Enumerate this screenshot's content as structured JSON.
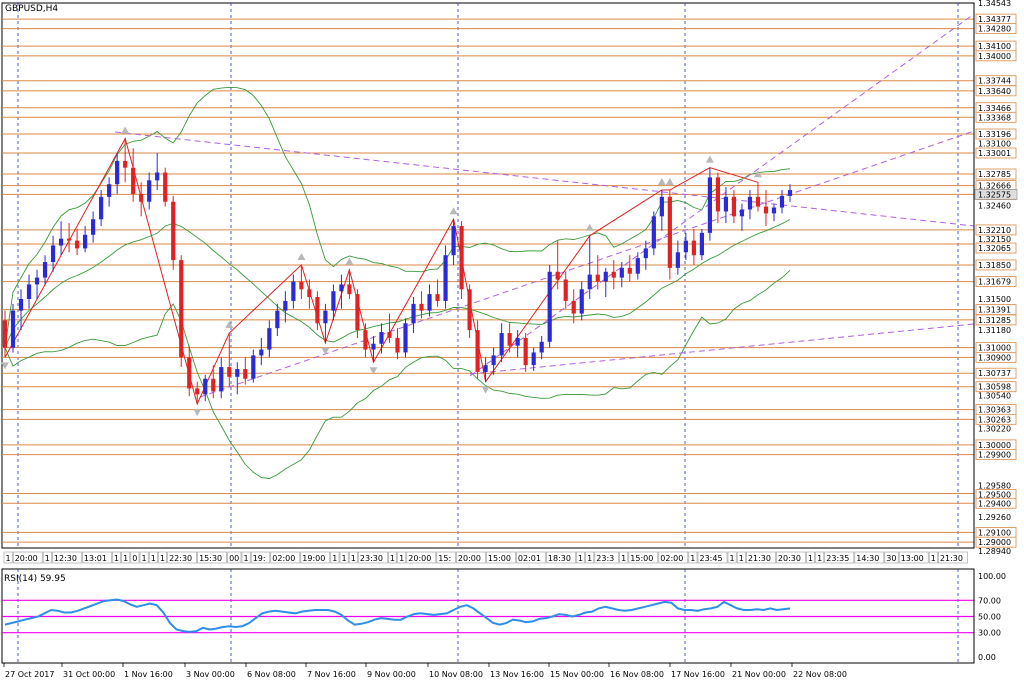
{
  "chart_data": [
    {
      "type": "candlestick",
      "title": "GBPUSD,H4",
      "ylim": [
        1.2894,
        1.34543
      ],
      "price_labels": [
        "1.34543",
        "1.34377",
        "1.34280",
        "1.34100",
        "1.34000",
        "1.33744",
        "1.33640",
        "1.33466",
        "1.33368",
        "1.33196",
        "1.33100",
        "1.33001",
        "1.32785",
        "1.32666",
        "1.32575",
        "1.32460",
        "1.32210",
        "1.32150",
        "1.32065",
        "1.31850",
        "1.31679",
        "1.31500",
        "1.31391",
        "1.31285",
        "1.31180",
        "1.31000",
        "1.30900",
        "1.30737",
        "1.30598",
        "1.30540",
        "1.30363",
        "1.30263",
        "1.30220",
        "1.30000",
        "1.29900",
        "1.29580",
        "1.29500",
        "1.29400",
        "1.29260",
        "1.29100",
        "1.29000",
        "1.28940"
      ],
      "current_price": "1.32575",
      "horizontal_levels": [
        1.34377,
        1.3428,
        1.341,
        1.34,
        1.33744,
        1.3364,
        1.33466,
        1.33368,
        1.33196,
        1.33001,
        1.32785,
        1.32666,
        1.32575,
        1.3221,
        1.32065,
        1.3185,
        1.31679,
        1.31391,
        1.31285,
        1.31,
        1.309,
        1.30737,
        1.30598,
        1.30363,
        1.30263,
        1.3,
        1.299,
        1.295,
        1.294,
        1.291,
        1.29
      ],
      "candles": [
        [
          1.3128,
          1.3138,
          1.309,
          1.31
        ],
        [
          1.31,
          1.3145,
          1.3095,
          1.3138
        ],
        [
          1.3138,
          1.316,
          1.3118,
          1.315
        ],
        [
          1.315,
          1.3175,
          1.314,
          1.3165
        ],
        [
          1.3165,
          1.318,
          1.315,
          1.3172
        ],
        [
          1.3172,
          1.3195,
          1.3165,
          1.3188
        ],
        [
          1.3188,
          1.3215,
          1.3178,
          1.3205
        ],
        [
          1.3205,
          1.323,
          1.3195,
          1.3212
        ],
        [
          1.3212,
          1.3228,
          1.3198,
          1.321
        ],
        [
          1.321,
          1.3222,
          1.3195,
          1.3202
        ],
        [
          1.3202,
          1.3225,
          1.3198,
          1.3216
        ],
        [
          1.3216,
          1.324,
          1.3208,
          1.3232
        ],
        [
          1.3232,
          1.3262,
          1.3225,
          1.3255
        ],
        [
          1.3255,
          1.3275,
          1.3245,
          1.3268
        ],
        [
          1.3268,
          1.33,
          1.3258,
          1.3292
        ],
        [
          1.3292,
          1.3315,
          1.327,
          1.3285
        ],
        [
          1.3285,
          1.3305,
          1.325,
          1.3258
        ],
        [
          1.3258,
          1.327,
          1.3235,
          1.325
        ],
        [
          1.325,
          1.328,
          1.3242,
          1.3272
        ],
        [
          1.3272,
          1.33,
          1.3262,
          1.328
        ],
        [
          1.328,
          1.3285,
          1.3245,
          1.325
        ],
        [
          1.325,
          1.3256,
          1.318,
          1.319
        ],
        [
          1.319,
          1.3195,
          1.308,
          1.309
        ],
        [
          1.309,
          1.3102,
          1.305,
          1.3058
        ],
        [
          1.3058,
          1.3065,
          1.3042,
          1.3052
        ],
        [
          1.3052,
          1.3072,
          1.3045,
          1.3068
        ],
        [
          1.3068,
          1.3082,
          1.3048,
          1.3055
        ],
        [
          1.3055,
          1.309,
          1.3048,
          1.308
        ],
        [
          1.308,
          1.3115,
          1.306,
          1.307
        ],
        [
          1.307,
          1.3085,
          1.3052,
          1.3078
        ],
        [
          1.3078,
          1.309,
          1.3062,
          1.3068
        ],
        [
          1.3068,
          1.3098,
          1.3064,
          1.3092
        ],
        [
          1.3092,
          1.311,
          1.3082,
          1.3098
        ],
        [
          1.3098,
          1.3128,
          1.309,
          1.312
        ],
        [
          1.312,
          1.3145,
          1.3112,
          1.3138
        ],
        [
          1.3138,
          1.3158,
          1.3126,
          1.3148
        ],
        [
          1.3148,
          1.3175,
          1.314,
          1.3168
        ],
        [
          1.3168,
          1.3185,
          1.315,
          1.316
        ],
        [
          1.316,
          1.317,
          1.314,
          1.3152
        ],
        [
          1.3152,
          1.3158,
          1.3118,
          1.3125
        ],
        [
          1.3125,
          1.3145,
          1.3105,
          1.3138
        ],
        [
          1.3138,
          1.3165,
          1.3128,
          1.3158
        ],
        [
          1.3158,
          1.3175,
          1.314,
          1.3165
        ],
        [
          1.3165,
          1.318,
          1.315,
          1.3155
        ],
        [
          1.3155,
          1.316,
          1.311,
          1.3118
        ],
        [
          1.3118,
          1.3125,
          1.309,
          1.3098
        ],
        [
          1.3098,
          1.3112,
          1.3085,
          1.3104
        ],
        [
          1.3104,
          1.3125,
          1.3094,
          1.3116
        ],
        [
          1.3116,
          1.3135,
          1.3105,
          1.311
        ],
        [
          1.311,
          1.312,
          1.3088,
          1.3095
        ],
        [
          1.3095,
          1.313,
          1.309,
          1.3125
        ],
        [
          1.3125,
          1.3152,
          1.3115,
          1.3145
        ],
        [
          1.3145,
          1.3158,
          1.313,
          1.3138
        ],
        [
          1.3138,
          1.3165,
          1.3132,
          1.3155
        ],
        [
          1.3155,
          1.317,
          1.3142,
          1.3148
        ],
        [
          1.3148,
          1.3205,
          1.314,
          1.3195
        ],
        [
          1.3195,
          1.3232,
          1.3185,
          1.3225
        ],
        [
          1.3225,
          1.323,
          1.315,
          1.316
        ],
        [
          1.316,
          1.3165,
          1.311,
          1.3118
        ],
        [
          1.3118,
          1.3128,
          1.3068,
          1.3075
        ],
        [
          1.3075,
          1.309,
          1.3065,
          1.3082
        ],
        [
          1.3082,
          1.31,
          1.3072,
          1.3092
        ],
        [
          1.3092,
          1.3125,
          1.3085,
          1.3115
        ],
        [
          1.3115,
          1.3125,
          1.3095,
          1.3102
        ],
        [
          1.3102,
          1.3118,
          1.309,
          1.311
        ],
        [
          1.311,
          1.3115,
          1.3075,
          1.3082
        ],
        [
          1.3082,
          1.31,
          1.3076,
          1.3095
        ],
        [
          1.3095,
          1.3112,
          1.3088,
          1.3106
        ],
        [
          1.3106,
          1.3185,
          1.31,
          1.3178
        ],
        [
          1.3178,
          1.321,
          1.316,
          1.317
        ],
        [
          1.317,
          1.3178,
          1.314,
          1.3148
        ],
        [
          1.3148,
          1.316,
          1.3125,
          1.3135
        ],
        [
          1.3135,
          1.3168,
          1.3128,
          1.316
        ],
        [
          1.316,
          1.3215,
          1.315,
          1.3175
        ],
        [
          1.3175,
          1.3195,
          1.316,
          1.3168
        ],
        [
          1.3168,
          1.3182,
          1.3152,
          1.3178
        ],
        [
          1.3178,
          1.319,
          1.316,
          1.3172
        ],
        [
          1.3172,
          1.3188,
          1.3162,
          1.3182
        ],
        [
          1.3182,
          1.3195,
          1.3168,
          1.3176
        ],
        [
          1.3176,
          1.3198,
          1.317,
          1.3192
        ],
        [
          1.3192,
          1.321,
          1.318,
          1.3202
        ],
        [
          1.3202,
          1.324,
          1.3195,
          1.3235
        ],
        [
          1.3235,
          1.3262,
          1.322,
          1.3255
        ],
        [
          1.3255,
          1.3262,
          1.317,
          1.3182
        ],
        [
          1.3182,
          1.321,
          1.3175,
          1.3198
        ],
        [
          1.3198,
          1.3218,
          1.319,
          1.321
        ],
        [
          1.321,
          1.3222,
          1.3185,
          1.3195
        ],
        [
          1.3195,
          1.3222,
          1.319,
          1.3218
        ],
        [
          1.3218,
          1.3285,
          1.321,
          1.3275
        ],
        [
          1.3275,
          1.328,
          1.3228,
          1.324
        ],
        [
          1.324,
          1.3265,
          1.3228,
          1.3255
        ],
        [
          1.3255,
          1.3262,
          1.3228,
          1.3235
        ],
        [
          1.3235,
          1.3248,
          1.322,
          1.3242
        ],
        [
          1.3242,
          1.3262,
          1.3232,
          1.3255
        ],
        [
          1.3255,
          1.327,
          1.324,
          1.3245
        ],
        [
          1.3245,
          1.3262,
          1.3225,
          1.3238
        ],
        [
          1.3238,
          1.3248,
          1.323,
          1.3244
        ],
        [
          1.3244,
          1.3262,
          1.3238,
          1.3256
        ],
        [
          1.3256,
          1.3268,
          1.325,
          1.3262
        ]
      ],
      "x_time_labels": [
        "27 Oct 2017",
        "31 Oct 00:00",
        "1 Nov 16:00",
        "3 Nov 00:00",
        "6 Nov 08:00",
        "7 Nov 16:00",
        "9 Nov 00:00",
        "10 Nov 08:00",
        "13 Nov 16:00",
        "15 Nov 00:00",
        "16 Nov 08:00",
        "17 Nov 16:00",
        "21 Nov 00:00",
        "22 Nov 08:00"
      ],
      "event_markers": [
        "1",
        "20:00",
        "1",
        "12:30",
        "13:01",
        "1",
        "1",
        "0",
        "1",
        "1",
        "1",
        "22:30",
        "15:30",
        "00",
        "1",
        "19:",
        "02:00",
        "19:00",
        "1",
        "1",
        "1",
        "23:30",
        "1",
        "1",
        "20:00",
        "15:",
        "20:00",
        "15:00",
        "02:01",
        "18:30",
        "1",
        "1",
        "23:3",
        "1",
        "15:00",
        "02:00",
        "1",
        "23:45",
        "1",
        "1",
        "21:30",
        "20:30",
        "1",
        "1",
        "23:35",
        "14:30",
        "30",
        "13:00",
        "1",
        "21:30"
      ]
    },
    {
      "type": "line",
      "title": "RSI(14) 59.95",
      "ylim": [
        0,
        100
      ],
      "y_ticks": [
        "100.00",
        "70.00",
        "50.00",
        "30.00",
        "0.00"
      ],
      "levels": [
        70,
        50,
        30
      ],
      "values": [
        40,
        42,
        44,
        46,
        48,
        50,
        54,
        58,
        57,
        55,
        55,
        57,
        60,
        63,
        66,
        69,
        70,
        71,
        69,
        65,
        62,
        64,
        66,
        64,
        55,
        42,
        34,
        32,
        31,
        32,
        36,
        34,
        35,
        37,
        38,
        37,
        38,
        42,
        48,
        54,
        56,
        57,
        56,
        55,
        54,
        56,
        57,
        58,
        58,
        58,
        56,
        52,
        45,
        40,
        41,
        43,
        46,
        48,
        47,
        46,
        46,
        50,
        53,
        54,
        53,
        52,
        53,
        54,
        58,
        62,
        64,
        60,
        54,
        48,
        42,
        40,
        42,
        46,
        45,
        43,
        44,
        47,
        48,
        50,
        53,
        52,
        50,
        52,
        55,
        56,
        60,
        62,
        60,
        58,
        57,
        58,
        60,
        62,
        64,
        66,
        68,
        67,
        60,
        58,
        58,
        57,
        59,
        60,
        62,
        68,
        64,
        60,
        58,
        58,
        59,
        58,
        60,
        58,
        59,
        60
      ]
    }
  ]
}
